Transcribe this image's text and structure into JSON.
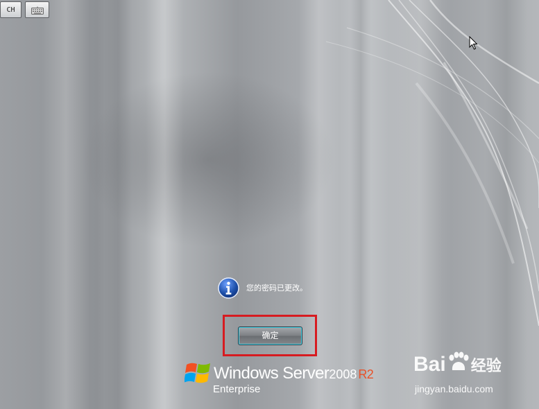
{
  "top_bar": {
    "language_label": "CH"
  },
  "dialog": {
    "message": "您的密码已更改。",
    "ok_label": "确定"
  },
  "branding": {
    "product_name": "Windows Server",
    "version": "2008",
    "edition_tag": "R2",
    "edition": "Enterprise"
  },
  "watermark": {
    "logo_start": "Bai",
    "logo_end": "经验",
    "url": "jingyan.baidu.com"
  },
  "colors": {
    "highlight_border": "#d71b20",
    "button_glow": "#49d6e8",
    "info_icon": "#1d4fa8",
    "r2_accent": "#e8522a"
  }
}
